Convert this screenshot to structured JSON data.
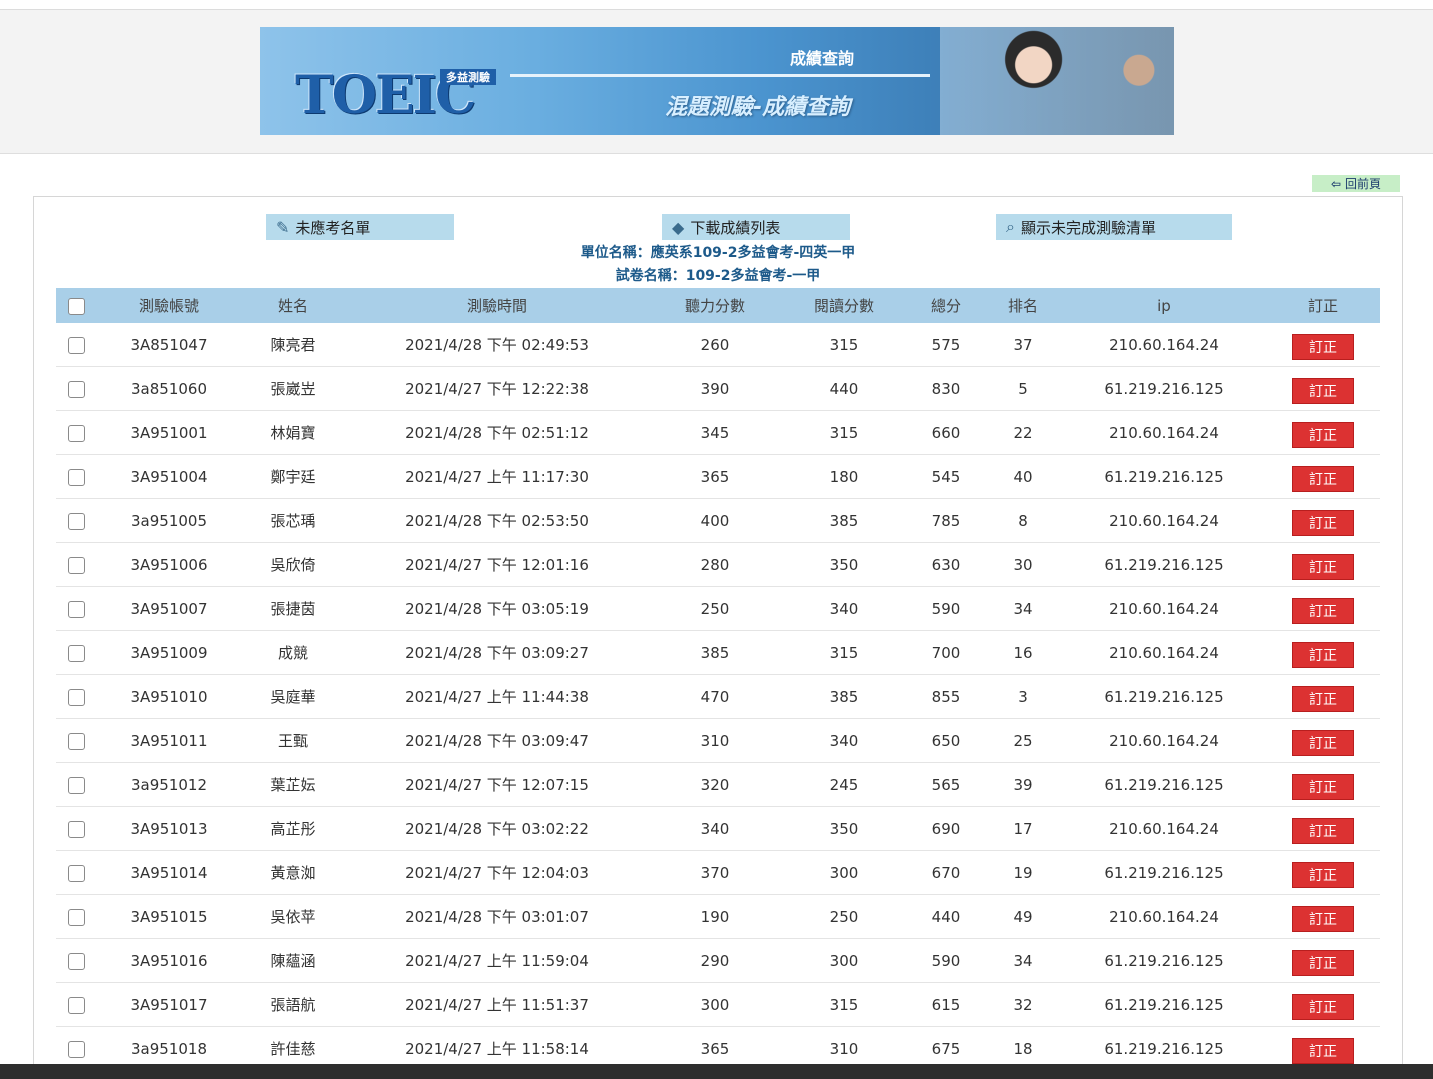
{
  "banner": {
    "logo_text": "TOEIC",
    "logo_sub": "多益測驗",
    "title": "成績查詢",
    "subtitle": "混題測驗-成績查詢"
  },
  "back_button": {
    "label": "回前頁",
    "icon": "back-arrow-icon"
  },
  "actions": {
    "absent_list": {
      "label": "未應考名單",
      "icon": "notebook-icon"
    },
    "download_list": {
      "label": "下載成績列表",
      "icon": "book-icon"
    },
    "incomplete_list": {
      "label": "顯示未完成測驗清單",
      "icon": "magnifier-icon"
    }
  },
  "info": {
    "unit": "單位名稱：應英系109-2多益會考-四英一甲",
    "paper": "試卷名稱：109-2多益會考-一甲"
  },
  "table": {
    "headers": [
      "測驗帳號",
      "姓名",
      "測驗時間",
      "聽力分數",
      "閱讀分數",
      "總分",
      "排名",
      "ip",
      "訂正"
    ],
    "fix_label": "訂正",
    "rows": [
      {
        "account": "3A851047",
        "name": "陳亮君",
        "time": "2021/4/28 下午 02:49:53",
        "listening": "260",
        "reading": "315",
        "total": "575",
        "rank": "37",
        "ip": "210.60.164.24"
      },
      {
        "account": "3a851060",
        "name": "張崴岦",
        "time": "2021/4/27 下午 12:22:38",
        "listening": "390",
        "reading": "440",
        "total": "830",
        "rank": "5",
        "ip": "61.219.216.125"
      },
      {
        "account": "3A951001",
        "name": "林娟寶",
        "time": "2021/4/28 下午 02:51:12",
        "listening": "345",
        "reading": "315",
        "total": "660",
        "rank": "22",
        "ip": "210.60.164.24"
      },
      {
        "account": "3A951004",
        "name": "鄭宇廷",
        "time": "2021/4/27 上午 11:17:30",
        "listening": "365",
        "reading": "180",
        "total": "545",
        "rank": "40",
        "ip": "61.219.216.125"
      },
      {
        "account": "3a951005",
        "name": "張芯瑀",
        "time": "2021/4/28 下午 02:53:50",
        "listening": "400",
        "reading": "385",
        "total": "785",
        "rank": "8",
        "ip": "210.60.164.24"
      },
      {
        "account": "3A951006",
        "name": "吳欣倚",
        "time": "2021/4/27 下午 12:01:16",
        "listening": "280",
        "reading": "350",
        "total": "630",
        "rank": "30",
        "ip": "61.219.216.125"
      },
      {
        "account": "3A951007",
        "name": "張捷茵",
        "time": "2021/4/28 下午 03:05:19",
        "listening": "250",
        "reading": "340",
        "total": "590",
        "rank": "34",
        "ip": "210.60.164.24"
      },
      {
        "account": "3A951009",
        "name": "成競",
        "time": "2021/4/28 下午 03:09:27",
        "listening": "385",
        "reading": "315",
        "total": "700",
        "rank": "16",
        "ip": "210.60.164.24"
      },
      {
        "account": "3A951010",
        "name": "吳庭華",
        "time": "2021/4/27 上午 11:44:38",
        "listening": "470",
        "reading": "385",
        "total": "855",
        "rank": "3",
        "ip": "61.219.216.125"
      },
      {
        "account": "3A951011",
        "name": "王甄",
        "time": "2021/4/28 下午 03:09:47",
        "listening": "310",
        "reading": "340",
        "total": "650",
        "rank": "25",
        "ip": "210.60.164.24"
      },
      {
        "account": "3a951012",
        "name": "葉芷妘",
        "time": "2021/4/27 下午 12:07:15",
        "listening": "320",
        "reading": "245",
        "total": "565",
        "rank": "39",
        "ip": "61.219.216.125"
      },
      {
        "account": "3A951013",
        "name": "高芷彤",
        "time": "2021/4/28 下午 03:02:22",
        "listening": "340",
        "reading": "350",
        "total": "690",
        "rank": "17",
        "ip": "210.60.164.24"
      },
      {
        "account": "3A951014",
        "name": "黃意洳",
        "time": "2021/4/27 下午 12:04:03",
        "listening": "370",
        "reading": "300",
        "total": "670",
        "rank": "19",
        "ip": "61.219.216.125"
      },
      {
        "account": "3A951015",
        "name": "吳依苹",
        "time": "2021/4/28 下午 03:01:07",
        "listening": "190",
        "reading": "250",
        "total": "440",
        "rank": "49",
        "ip": "210.60.164.24"
      },
      {
        "account": "3A951016",
        "name": "陳蘊涵",
        "time": "2021/4/27 上午 11:59:04",
        "listening": "290",
        "reading": "300",
        "total": "590",
        "rank": "34",
        "ip": "61.219.216.125"
      },
      {
        "account": "3A951017",
        "name": "張語航",
        "time": "2021/4/27 上午 11:51:37",
        "listening": "300",
        "reading": "315",
        "total": "615",
        "rank": "32",
        "ip": "61.219.216.125"
      },
      {
        "account": "3a951018",
        "name": "許佳慈",
        "time": "2021/4/27 上午 11:58:14",
        "listening": "365",
        "reading": "310",
        "total": "675",
        "rank": "18",
        "ip": "61.219.216.125"
      }
    ]
  },
  "colors": {
    "header_bg": "#a9cfe8",
    "action_bg": "#b7dbec",
    "fix_button": "#dc3232",
    "back_button_bg": "#c7eec7",
    "info_text": "#1d5a8a"
  }
}
